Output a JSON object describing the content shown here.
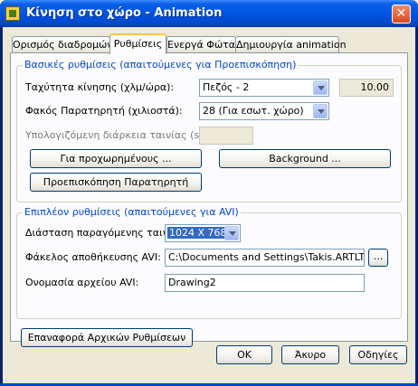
{
  "window": {
    "title": "Κίνηση στο χώρο - Animation",
    "close_glyph": "✕",
    "icon": "app-icon"
  },
  "tabs": [
    {
      "label": "Ορισμός διαδρομών",
      "active": false
    },
    {
      "label": "Ρυθμίσεις",
      "active": true
    },
    {
      "label": "Ενεργά Φώτα",
      "active": false
    },
    {
      "label": "Δημιουργία animation",
      "active": false
    }
  ],
  "basic": {
    "group_label": "Βασικές ρυθμίσεις (απαιτούμενες για Προεπισκόπηση)",
    "speed_label": "Ταχύτητα κίνησης (χλμ/ώρα):",
    "speed_value": "Πεζός - 2",
    "speed_numeric": "10.00",
    "lens_label": "Φακός Παρατηρητή (χιλιοστά):",
    "lens_value": "28 (Για εσωτ. χώρο)",
    "duration_label": "Υπολογιζόμενη διάρκεια ταινίας (sec):",
    "duration_value": "",
    "advanced_button": "Για προχωρημένους ...",
    "background_button": "Background ...",
    "preview_button": "Προεπισκόπηση Παρατηρητή"
  },
  "avi": {
    "group_label": "Επιπλέον ρυθμίσεις (απαιτούμενες για AVI)",
    "dimension_label": "Διάσταση παραγόμενης ταινίας:",
    "dimension_value": "1024 X 768",
    "folder_label": "Φάκελος αποθήκευσης AVI:",
    "folder_value": "C:\\Documents and Settings\\Takis.ARTLTD\\My",
    "browse_button": "...",
    "filename_label": "Ονομασία αρχείου AVI:",
    "filename_value": "Drawing2"
  },
  "reset_button": "Επαναφορά Αρχικών Ρυθμίσεων",
  "footer": {
    "ok": "OK",
    "cancel": "Άκυρο",
    "help": "Οδηγίες"
  },
  "colors": {
    "accent": "#0046d5",
    "titlebar": "#0054e3",
    "selection": "#316ac5"
  }
}
